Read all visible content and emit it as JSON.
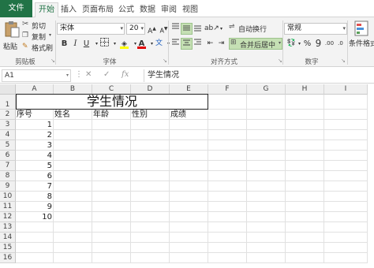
{
  "tabs": [
    {
      "label": "文件"
    },
    {
      "label": "开始"
    },
    {
      "label": "插入"
    },
    {
      "label": "页面布局"
    },
    {
      "label": "公式"
    },
    {
      "label": "数据"
    },
    {
      "label": "审阅"
    },
    {
      "label": "视图"
    }
  ],
  "ribbon": {
    "clipboard": {
      "paste": "粘贴",
      "cut": "剪切",
      "copy": "复制",
      "format_painter": "格式刷",
      "group": "剪贴板"
    },
    "font": {
      "name": "宋体",
      "size": "20",
      "group": "字体",
      "bold": "B",
      "italic": "I",
      "underline": "U"
    },
    "alignment": {
      "wrap_text": "自动换行",
      "merge_center": "合并后居中",
      "group": "对齐方式"
    },
    "number": {
      "format": "常规",
      "percent": "%",
      "comma": "9",
      "group": "数字"
    },
    "styles": {
      "conditional_format": "条件格式"
    }
  },
  "formula_bar": {
    "name_box": "A1",
    "fx": "fx",
    "content": "学生情况"
  },
  "columns": [
    "A",
    "B",
    "C",
    "D",
    "E",
    "F",
    "G",
    "H",
    "I"
  ],
  "rows": [
    "1",
    "2",
    "3",
    "4",
    "5",
    "6",
    "7",
    "8",
    "9",
    "10",
    "11",
    "12",
    "13",
    "14",
    "15",
    "16"
  ],
  "sheet": {
    "title": "学生情况",
    "headers": [
      "序号",
      "姓名",
      "年龄",
      "性别",
      "成绩"
    ],
    "numbers": [
      "1",
      "2",
      "3",
      "4",
      "5",
      "6",
      "7",
      "8",
      "9",
      "10"
    ]
  },
  "colors": {
    "accent": "#217346",
    "highlight": "#c5e0b4",
    "font_color": "#e00000",
    "fill_color": "#ffff00"
  }
}
